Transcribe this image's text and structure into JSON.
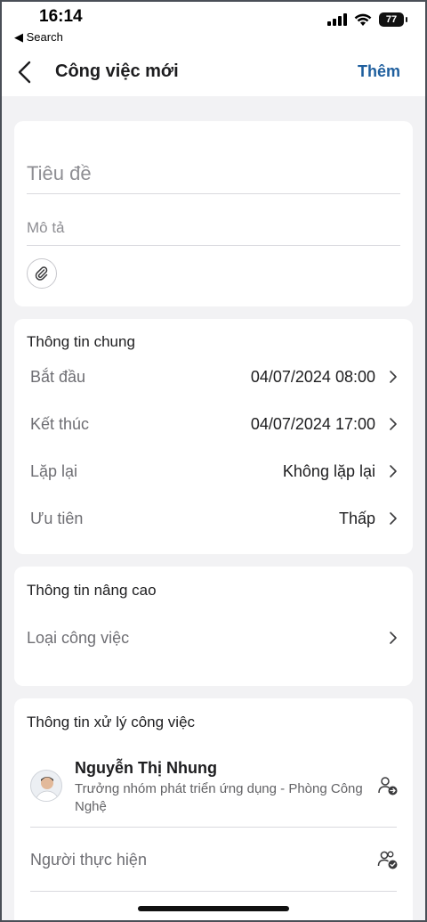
{
  "status_bar": {
    "time": "16:14",
    "back_app": "◀ Search",
    "battery": "77"
  },
  "nav": {
    "title": "Công việc mới",
    "action_label": "Thêm"
  },
  "form": {
    "title_placeholder": "Tiêu đề",
    "description_placeholder": "Mô tả",
    "attach_icon": "paperclip-icon"
  },
  "general_info": {
    "heading": "Thông tin chung",
    "rows": [
      {
        "label": "Bắt đầu",
        "value": "04/07/2024 08:00"
      },
      {
        "label": "Kết thúc",
        "value": "04/07/2024 17:00"
      },
      {
        "label": "Lặp lại",
        "value": "Không lặp lại"
      },
      {
        "label": "Ưu tiên",
        "value": "Thấp"
      }
    ]
  },
  "advanced_info": {
    "heading": "Thông tin nâng cao",
    "task_type_label": "Loại công việc"
  },
  "processing_info": {
    "heading": "Thông tin xử lý công việc",
    "owner": {
      "name": "Nguyễn Thị Nhung",
      "role": "Trưởng nhóm phát triển ứng dụng - Phòng Công Nghệ"
    },
    "assignee_label": "Người thực hiện"
  },
  "colors": {
    "accent": "#1f5f9e",
    "background": "#f2f2f4",
    "card": "#ffffff",
    "muted_text": "#6e6e73"
  }
}
